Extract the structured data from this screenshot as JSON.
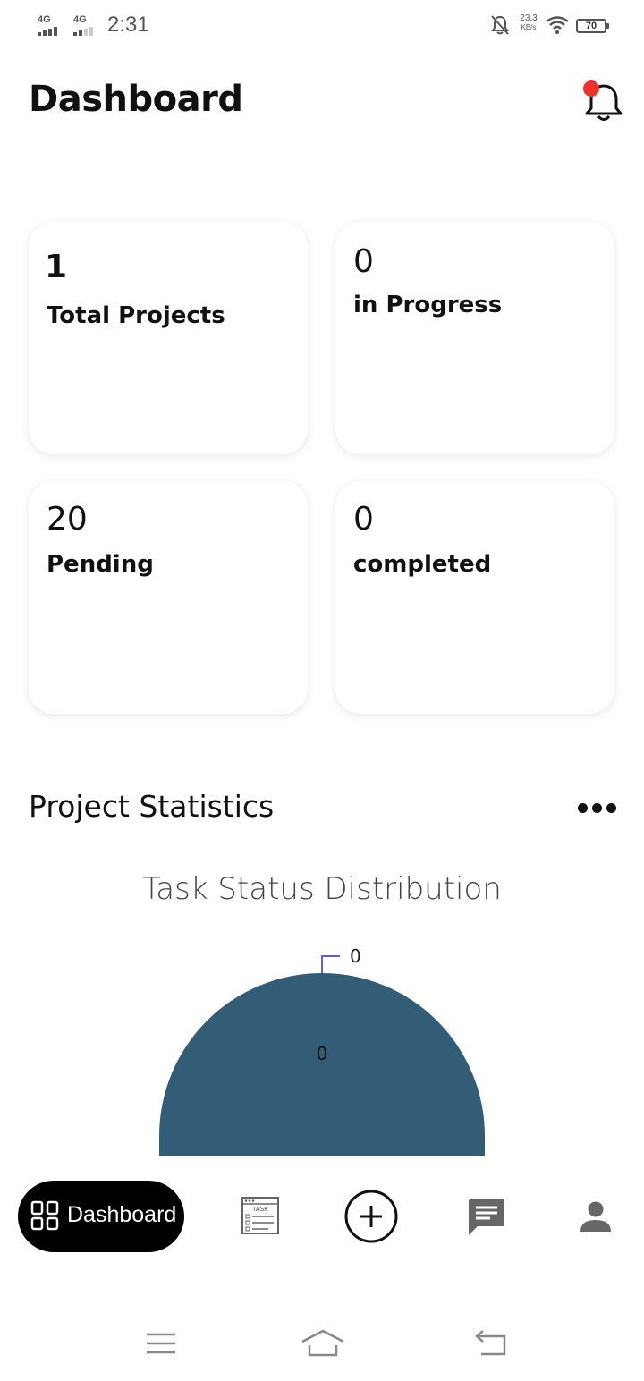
{
  "status_bar": {
    "signal1": "4G",
    "signal2": "4G",
    "time": "2:31",
    "net_speed": "23.3",
    "net_unit": "KB/s",
    "battery": "70",
    "icons": [
      "signal-icon",
      "mute-icon",
      "wifi-icon",
      "battery-icon"
    ]
  },
  "header": {
    "title": "Dashboard",
    "notification_icon": "bell-icon",
    "notification_dot_color": "#f0312a"
  },
  "cards": [
    {
      "value": "1",
      "label": "Total Projects"
    },
    {
      "value": "0",
      "label": "in Progress"
    },
    {
      "value": "20",
      "label": "Pending"
    },
    {
      "value": "0",
      "label": "completed"
    }
  ],
  "statistics": {
    "title": "Project Statistics",
    "more_icon": "more-horizontal-icon"
  },
  "chart_data": {
    "type": "pie",
    "title": "Task Status Distribution",
    "slices": [
      {
        "value": 0,
        "label": "0",
        "color": "#335c77"
      },
      {
        "value": 0,
        "label": "0",
        "color": "#6a5acd"
      }
    ],
    "slice_label": "0",
    "outer_label": "0",
    "fill_color": "#335c77",
    "leader_color": "#6a5acd"
  },
  "bottom_nav": {
    "active_label": "Dashboard",
    "items": [
      "dashboard-icon",
      "task-icon",
      "add-icon",
      "chat-icon",
      "profile-icon"
    ]
  },
  "system_nav": [
    "menu-icon",
    "home-icon",
    "back-icon"
  ]
}
